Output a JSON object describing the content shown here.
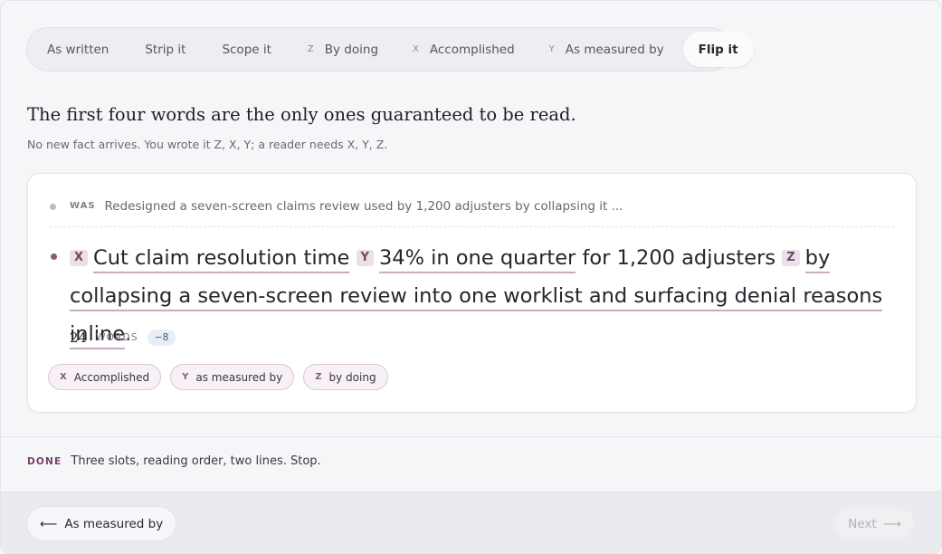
{
  "tabs": [
    {
      "label": "As written",
      "letter": ""
    },
    {
      "label": "Strip it",
      "letter": ""
    },
    {
      "label": "Scope it",
      "letter": ""
    },
    {
      "label": "By doing",
      "letter": "Z"
    },
    {
      "label": "Accomplished",
      "letter": "X"
    },
    {
      "label": "As measured by",
      "letter": "Y"
    },
    {
      "label": "Flip it",
      "letter": ""
    }
  ],
  "headline": "The first four words are the only ones guaranteed to be read.",
  "subline": "No new fact arrives. You wrote it Z, X, Y; a reader needs X, Y, Z.",
  "card": {
    "was_label": "WAS",
    "was_text": "Redesigned a seven-screen claims review used by 1,200 adjusters by collapsing it ...",
    "sentence": {
      "x_tag": "X",
      "x_text": "Cut claim resolution time",
      "y_tag": "Y",
      "y_text": "34% in one quarter",
      "mid_text": " for 1,200 adjusters ",
      "z_tag": "Z",
      "z_text": "by collapsing a seven-screen review into one worklist and surfacing denial reasons inline",
      "end": "."
    },
    "word_count": "24",
    "words_label": "WORDS",
    "delta": "−8",
    "chips": [
      {
        "letter": "X",
        "label": "Accomplished"
      },
      {
        "letter": "Y",
        "label": "as measured by"
      },
      {
        "letter": "Z",
        "label": "by doing"
      }
    ]
  },
  "done": {
    "label": "DONE",
    "text": "Three slots, reading order, two lines. Stop."
  },
  "footer": {
    "back_label": "As measured by",
    "back_arrow": "⟵",
    "next_label": "Next",
    "next_arrow": "⟶"
  }
}
